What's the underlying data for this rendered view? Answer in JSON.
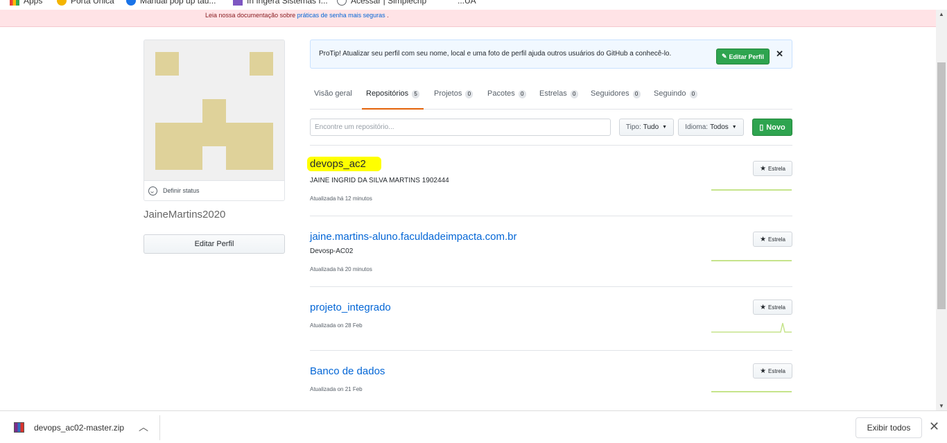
{
  "bookmarks": [
    {
      "label": "Apps",
      "color": "#e8a100"
    },
    {
      "label": "Porta Unica",
      "color": "#f4b400"
    },
    {
      "label": "Manual pop up tau...",
      "color": "#1a73e8"
    },
    {
      "label": "In Ingera Sistemas I...",
      "color": "#7e57c2"
    },
    {
      "label": "Acessar | Simplecrip",
      "color": "#5f6368"
    },
    {
      "label": "...UA",
      "color": "#5f6368"
    }
  ],
  "flash": {
    "prefix": "Leia nossa documentação sobre",
    "link": "práticas de senha mais seguras",
    "suffix": "."
  },
  "profile": {
    "username": "JaineMartins2020",
    "status_label": "Definir status",
    "edit_label": "Editar Perfil",
    "avatar_color": "#dfd29a"
  },
  "protip": {
    "label": "ProTip!",
    "text": "Atualizar seu perfil com seu nome, local e uma foto de perfil ajuda outros usuários do GitHub a conhecê-lo.",
    "button": "Editar Perfil"
  },
  "tabs": [
    {
      "label": "Visão geral",
      "count": ""
    },
    {
      "label": "Repositórios",
      "count": "5"
    },
    {
      "label": "Projetos",
      "count": "0"
    },
    {
      "label": "Pacotes",
      "count": "0"
    },
    {
      "label": "Estrelas",
      "count": "0"
    },
    {
      "label": "Seguidores",
      "count": "0"
    },
    {
      "label": "Seguindo",
      "count": "0"
    }
  ],
  "filters": {
    "search_placeholder": "Encontre um repositório...",
    "type_key": "Tipo:",
    "type_value": "Tudo",
    "lang_key": "Idioma:",
    "lang_value": "Todos",
    "new_label": "Novo"
  },
  "repos": [
    {
      "name": "devops_ac2",
      "description": "JAINE INGRID DA SILVA MARTINS 1902444",
      "updated": "Atualizada há 12 minutos",
      "star": "Estrela"
    },
    {
      "name": "jaine.martins-aluno.faculdadeimpacta.com.br",
      "description": "Devosp-AC02",
      "updated": "Atualizada há 20 minutos",
      "star": "Estrela"
    },
    {
      "name": "projeto_integrado",
      "description": "",
      "updated": "Atualizada on 28 Feb",
      "star": "Estrela"
    },
    {
      "name": "Banco de dados",
      "description": "",
      "updated": "Atualizada on 21 Feb",
      "star": "Estrela"
    }
  ],
  "downloads": {
    "file": "devops_ac02-master.zip",
    "show_all": "Exibir todos"
  }
}
